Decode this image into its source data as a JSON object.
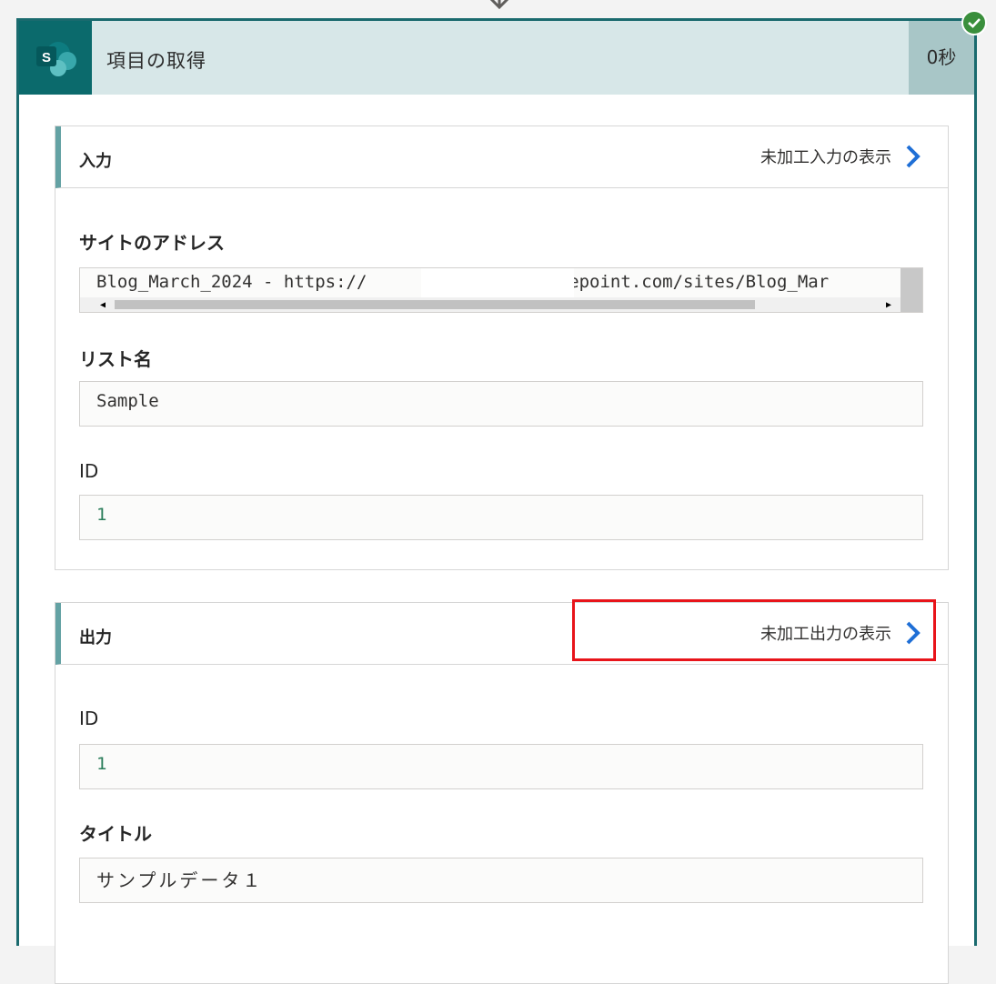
{
  "action": {
    "title": "項目の取得",
    "duration": "0秒",
    "status": "succeeded",
    "connector_icon": "sharepoint-icon"
  },
  "colors": {
    "accent": "#0b6a6c",
    "header_bg": "#d7e7e8",
    "link_chevron": "#1f6fd6",
    "highlight": "#e8141a",
    "success": "#3a8f3c"
  },
  "inputs": {
    "title": "入力",
    "raw_link": "未加工入力の表示",
    "site_label": "サイトのアドレス",
    "site_value": "Blog_March_2024 - https://",
    "site_value_suffix": "sharepoint.com/sites/Blog_Mar",
    "list_label": "リスト名",
    "list_value": "Sample",
    "id_label": "ID",
    "id_value": "1"
  },
  "outputs": {
    "title": "出力",
    "raw_link": "未加工出力の表示",
    "id_label": "ID",
    "id_value": "1",
    "title_label": "タイトル",
    "title_value": "サンプルデータ１"
  }
}
